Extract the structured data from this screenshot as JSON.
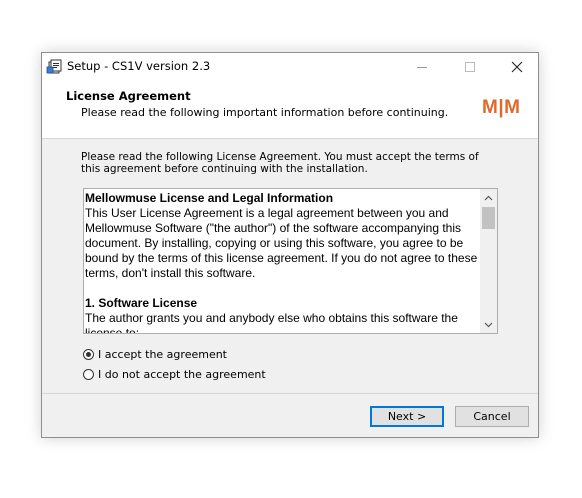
{
  "window": {
    "title": "Setup - CS1V version 2.3"
  },
  "header": {
    "title": "License Agreement",
    "subtitle": "Please read the following important information before continuing.",
    "logo_text": "M|M",
    "logo_color": "#e06a2c"
  },
  "body": {
    "intro": "Please read the following License Agreement. You must accept the terms of this agreement before continuing with the installation.",
    "license": {
      "heading": "Mellowmuse License and Legal Information",
      "paragraph1": "This User License Agreement is a legal agreement between you and Mellowmuse Software (\"the author\") of the software accompanying this document. By installing, copying or using this software, you agree to be bound by the terms of this license agreement. If you do not agree to these terms, don't install this software.",
      "section1_heading": "1. Software License",
      "section1_text": "The author grants you and anybody else who obtains this software the license to:"
    },
    "options": [
      {
        "label": "I accept the agreement",
        "selected": true
      },
      {
        "label": "I do not accept the agreement",
        "selected": false
      }
    ]
  },
  "buttons": {
    "next": "Next >",
    "cancel": "Cancel",
    "accent": "#0078d7"
  }
}
